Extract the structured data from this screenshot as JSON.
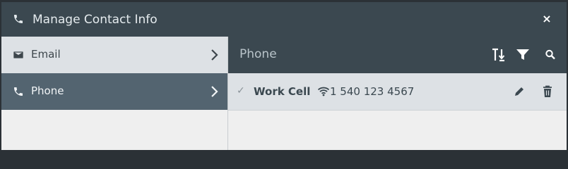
{
  "dialog": {
    "title": "Manage Contact Info",
    "title_icon": "phone-icon",
    "close_label": "×"
  },
  "sidebar": {
    "items": [
      {
        "label": "Email",
        "icon": "envelope-icon",
        "selected": false
      },
      {
        "label": "Phone",
        "icon": "phone-icon",
        "selected": true
      }
    ]
  },
  "panel": {
    "title": "Phone",
    "toolbar": [
      "sort-icon",
      "filter-icon",
      "search-icon"
    ],
    "rows": [
      {
        "name": "Work Cell",
        "number": "1 540 123 4567",
        "status_icon": "check-icon",
        "type_icon": "wifi-icon"
      }
    ]
  },
  "colors": {
    "header_bg": "#3b4850",
    "selected_nav_bg": "#536470",
    "row_bg": "#dde1e5",
    "body_bg": "#efefef"
  }
}
